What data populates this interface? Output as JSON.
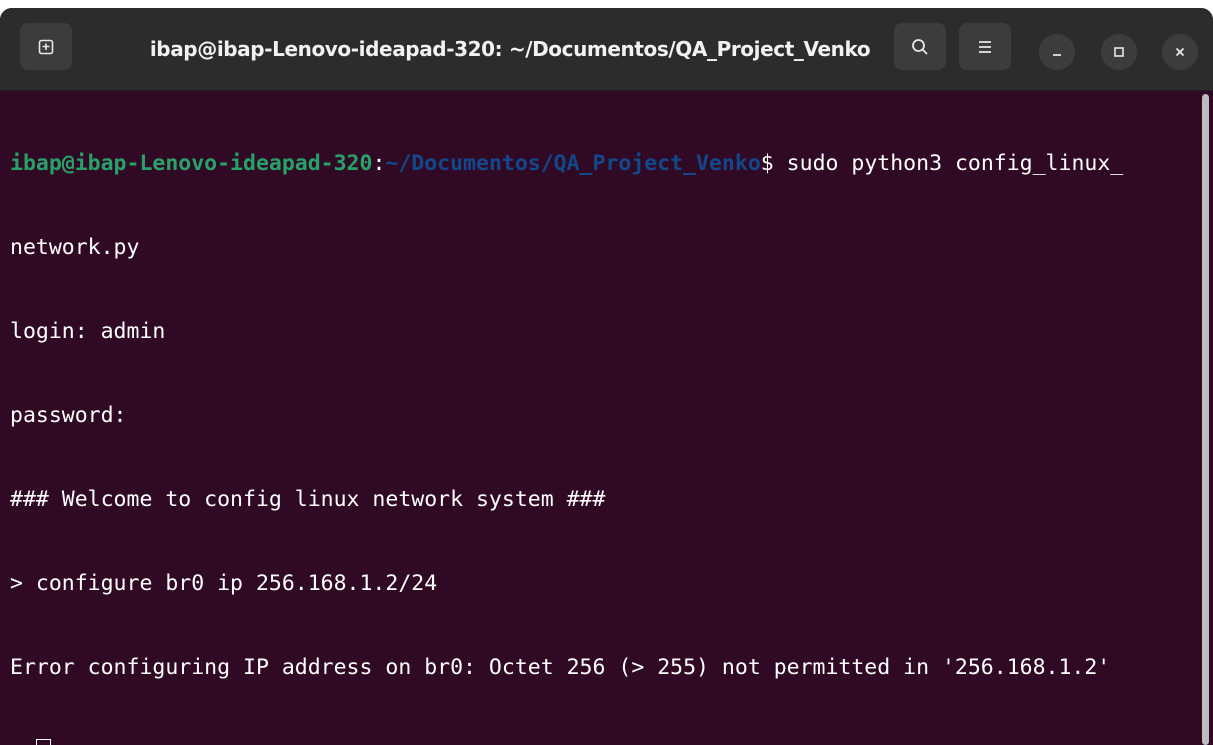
{
  "window": {
    "title": "ibap@ibap-Lenovo-ideapad-320: ~/Documentos/QA_Project_Venko",
    "background": "#300a24",
    "titlebar_color": "#2c2c2c"
  },
  "titlebar": {
    "new_tab_icon": "new-tab-icon",
    "search_icon": "search-icon",
    "menu_icon": "hamburger-menu-icon",
    "minimize_icon": "minimize-icon",
    "maximize_icon": "maximize-icon",
    "close_icon": "close-icon"
  },
  "terminal": {
    "prompt_user": "ibap@ibap-Lenovo-ideapad-320",
    "prompt_sep": ":",
    "prompt_path": "~/Documentos/QA_Project_Venko",
    "prompt_symbol": "$",
    "command": " sudo python3 config_linux_",
    "command_wrap": "network.py",
    "output": [
      "login: admin",
      "password:",
      "### Welcome to config linux network system ###",
      "> configure br0 ip 256.168.1.2/24",
      "Error configuring IP address on br0: Octet 256 (> 255) not permitted in '256.168.1.2'"
    ],
    "current_prompt": "> ",
    "colors": {
      "user": "#26a269",
      "path": "#12488b",
      "text": "#ffffff"
    }
  }
}
